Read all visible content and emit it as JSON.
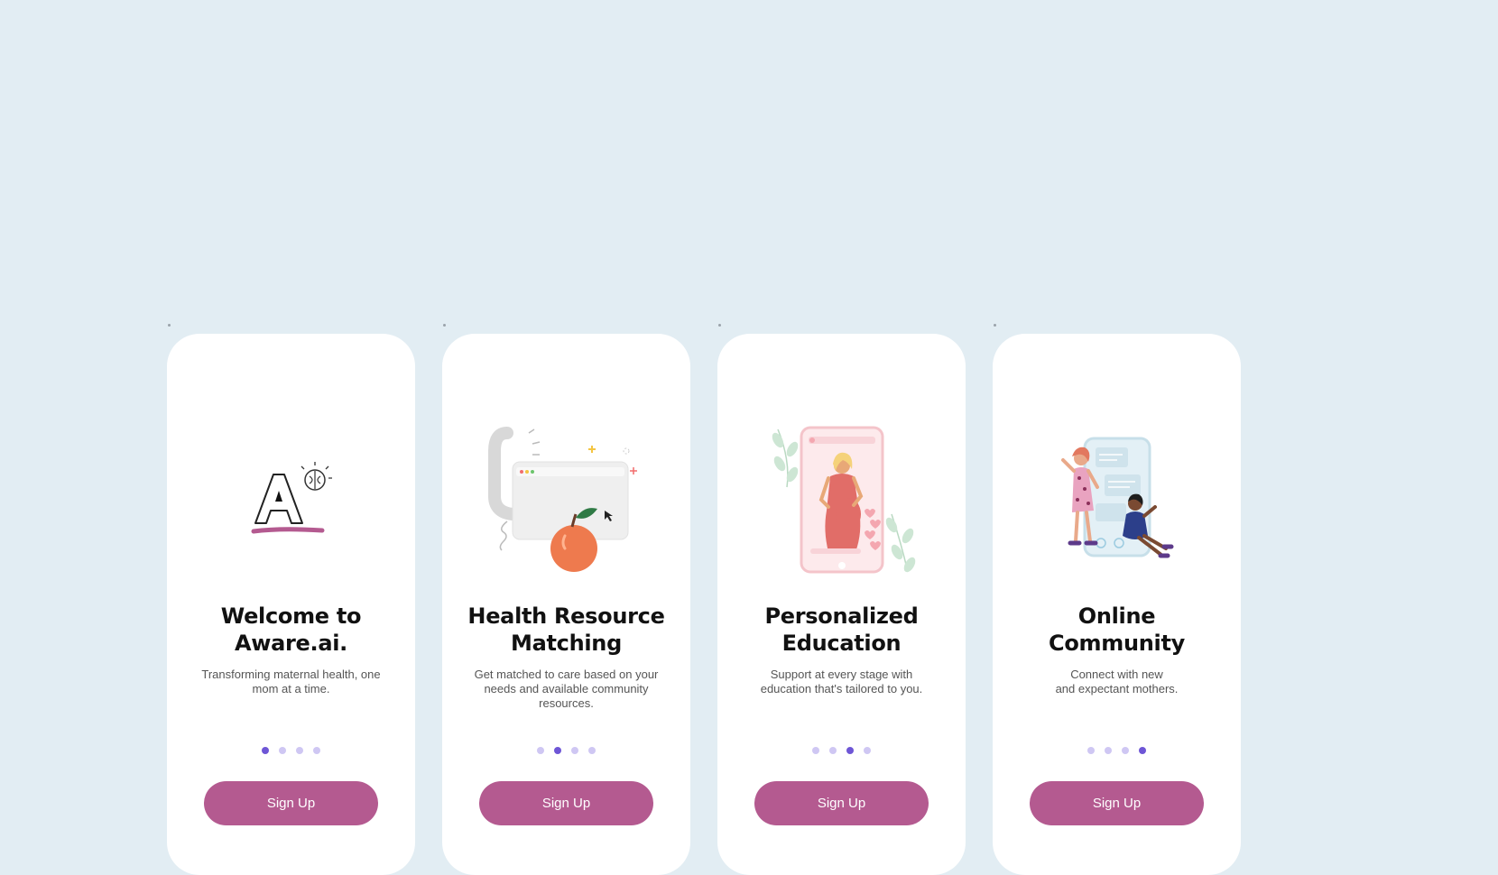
{
  "colors": {
    "background": "#e2edf3",
    "card": "#ffffff",
    "button": "#b45a90",
    "dot_active": "#6e56d6",
    "dot_inactive": "#cfc7f3"
  },
  "screens": [
    {
      "illustration": "aware-logo-icon",
      "title_line1": "Welcome to",
      "title_line2": "Aware.ai.",
      "desc_line1": "Transforming maternal health, one",
      "desc_line2": "mom at a time.",
      "desc_line3": "",
      "active_dot": 1,
      "button_label": "Sign Up"
    },
    {
      "illustration": "phone-apple-browser-illustration",
      "title_line1": "Health Resource",
      "title_line2": "Matching",
      "desc_line1": "Get matched to care based on your",
      "desc_line2": "needs and available community",
      "desc_line3": "resources.",
      "active_dot": 2,
      "button_label": "Sign Up"
    },
    {
      "illustration": "pregnant-woman-phone-illustration",
      "title_line1": "Personalized",
      "title_line2": "Education",
      "desc_line1": "Support at every stage with",
      "desc_line2": "education that's tailored to you.",
      "desc_line3": "",
      "active_dot": 3,
      "button_label": "Sign Up"
    },
    {
      "illustration": "women-chat-community-illustration",
      "title_line1": "Online",
      "title_line2": "Community",
      "desc_line1": "Connect with new",
      "desc_line2": "and expectant mothers.",
      "desc_line3": "",
      "active_dot": 4,
      "button_label": "Sign Up"
    }
  ]
}
